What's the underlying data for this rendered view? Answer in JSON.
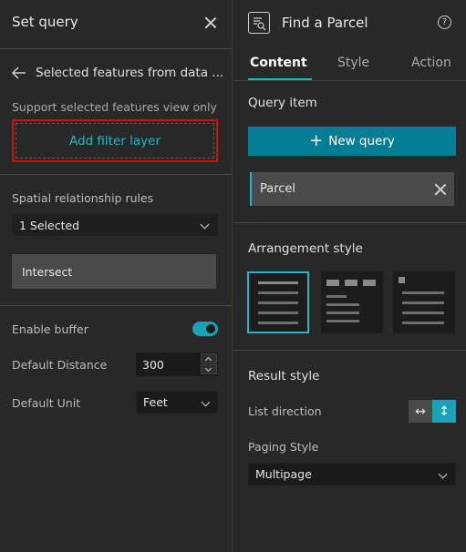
{
  "left_panel": {
    "title": "Set query",
    "back_title": "Selected features from data ...",
    "support_text": "Support selected features view only",
    "add_filter_label": "Add filter layer",
    "spatial_rules_label": "Spatial relationship rules",
    "spatial_select_value": "1 Selected",
    "selected_rule": "Intersect",
    "enable_buffer_label": "Enable buffer",
    "enable_buffer_on": true,
    "default_distance_label": "Default Distance",
    "default_distance_value": "300",
    "default_unit_label": "Default Unit",
    "default_unit_value": "Feet"
  },
  "right_panel": {
    "title": "Find a Parcel",
    "help_glyph": "?",
    "tabs": [
      {
        "label": "Content",
        "active": true
      },
      {
        "label": "Style",
        "active": false
      },
      {
        "label": "Action",
        "active": false
      }
    ],
    "query_item_title": "Query item",
    "new_query_label": "New query",
    "query_items": [
      "Parcel"
    ],
    "arrangement_title": "Arrangement style",
    "result_style_title": "Result style",
    "list_direction_label": "List direction",
    "paging_style_label": "Paging Style",
    "paging_style_value": "Multipage"
  },
  "colors": {
    "accent": "#22b6cc",
    "primary_button": "#047e92",
    "highlight_border": "#d01010"
  }
}
